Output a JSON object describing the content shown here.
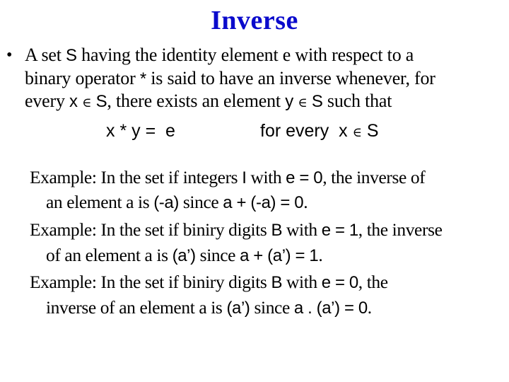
{
  "slide": {
    "title": "Inverse",
    "title_color": "#0a0acc",
    "bullet_symbol": "•",
    "definition": {
      "line1": {
        "t1": "A set ",
        "s1": "S",
        "t2": " having the identity element e with respect to a"
      },
      "line2": {
        "t1": "binary operator ",
        "s1": "*",
        "t2": " is said to have an inverse whenever, for"
      },
      "line3": {
        "t1": "every ",
        "s1": "x",
        "sym1": "∈",
        "s2": "S",
        "t2": ", there exists an element ",
        "s3": "y",
        "sym2": "∈",
        "s4": "S",
        "t3": " such that"
      }
    },
    "formula": {
      "left": "x * y =  e",
      "right_text": "for every  x",
      "right_sym": "∈",
      "right_set": "S"
    },
    "examples": [
      {
        "line1": {
          "t1": "Example: In the set if integers ",
          "s1": "I",
          "t2": " with ",
          "s2": "e = 0",
          "t3": ", the inverse of"
        },
        "line2": {
          "t1": "an element a is ",
          "s1": "(-a)",
          "t2": " since ",
          "s2": "a + (-a) = 0",
          "t3": "."
        }
      },
      {
        "line1": {
          "t1": "Example: In the set if biniry digits ",
          "s1": "B",
          "t2": " with ",
          "s2": "e = 1",
          "t3": ", the inverse"
        },
        "line2": {
          "t1": "of an element a is ",
          "s1": "(a’)",
          "t2": " since ",
          "s2": "a + (a’) = 1",
          "t3": "."
        }
      },
      {
        "line1": {
          "t1": "Example: In the set if biniry digits ",
          "s1": "B",
          "t2": " with ",
          "s2": "e = 0",
          "t3": ", the"
        },
        "line2": {
          "t1": "inverse of an element a is ",
          "s1": "(a’)",
          "t2": " since ",
          "s2": "a . (a’) = 0",
          "t3": "."
        }
      }
    ]
  }
}
